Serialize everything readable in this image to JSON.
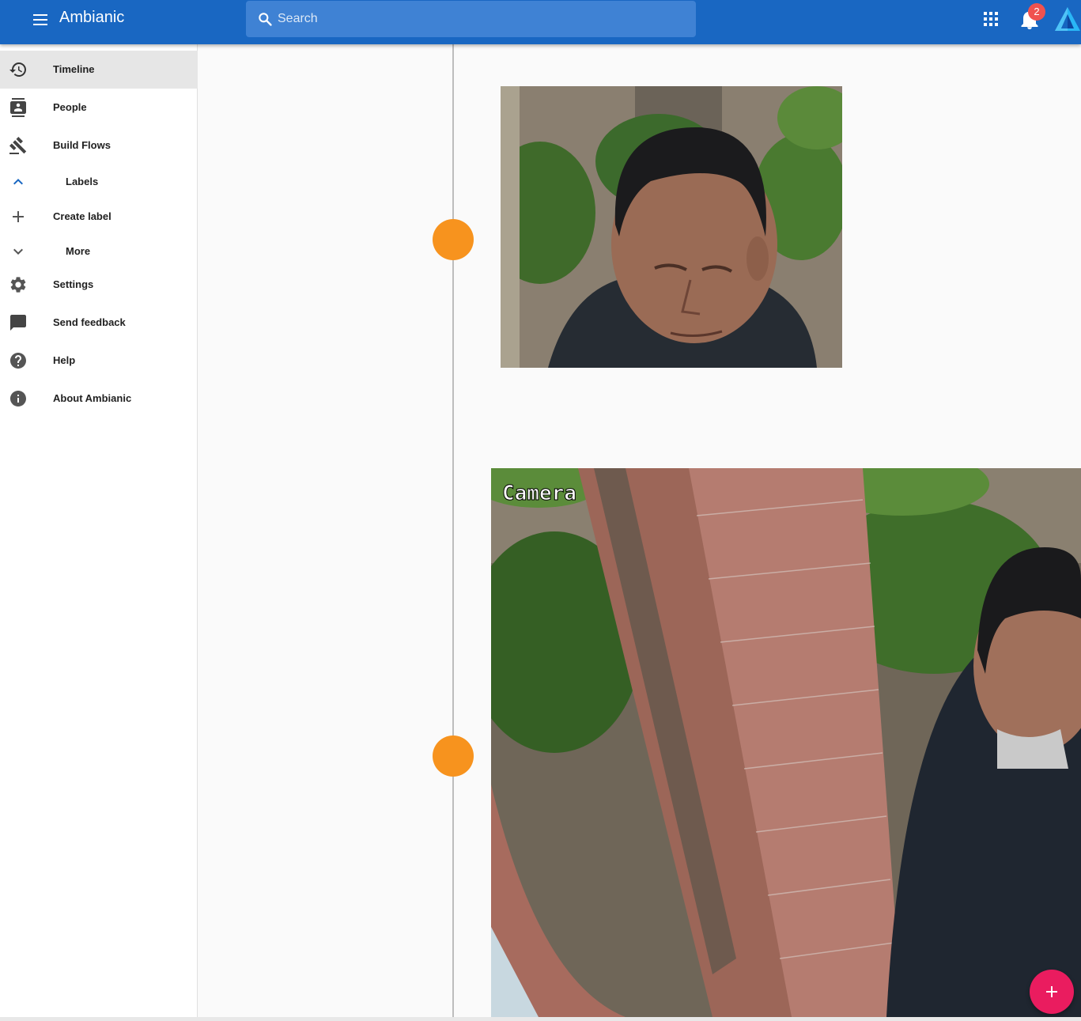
{
  "app": {
    "title": "Ambianic"
  },
  "search": {
    "placeholder": "Search"
  },
  "notifications": {
    "count": "2"
  },
  "sidebar": {
    "items": [
      {
        "label": "Timeline",
        "icon": "history-icon"
      },
      {
        "label": "People",
        "icon": "contacts-icon"
      },
      {
        "label": "Build Flows",
        "icon": "gavel-icon"
      },
      {
        "label": "Labels",
        "icon": "chevron-up-icon"
      },
      {
        "label": "Create label",
        "icon": "plus-icon"
      },
      {
        "label": "More",
        "icon": "chevron-down-icon"
      },
      {
        "label": "Settings",
        "icon": "gear-icon"
      },
      {
        "label": "Send feedback",
        "icon": "feedback-icon"
      },
      {
        "label": "Help",
        "icon": "help-icon"
      },
      {
        "label": "About Ambianic",
        "icon": "info-icon"
      }
    ]
  },
  "timeline": {
    "events": [
      {
        "image_overlay": ""
      },
      {
        "image_overlay": "Camera"
      }
    ]
  },
  "colors": {
    "appbar": "#1967c2",
    "timeline_dot": "#f7931e",
    "fab": "#ea1c5f",
    "badge": "#f0524f"
  }
}
